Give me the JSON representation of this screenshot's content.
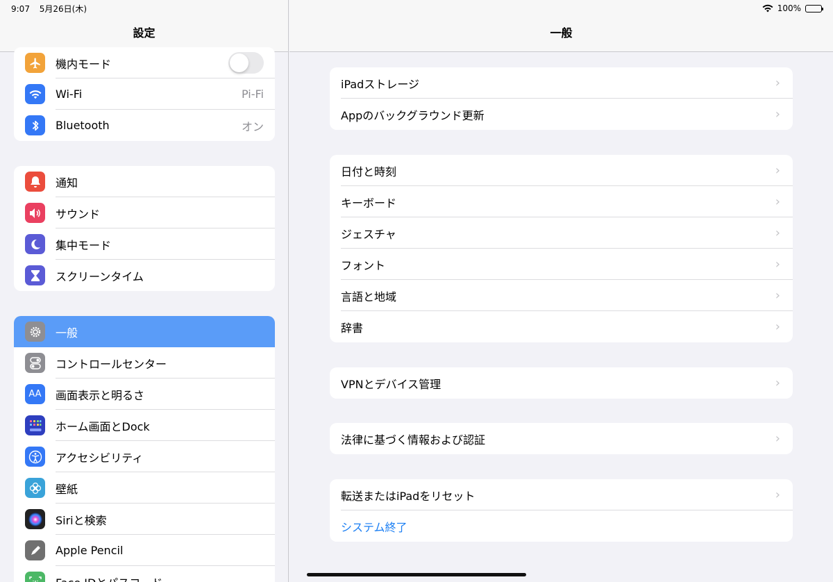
{
  "status": {
    "time": "9:07",
    "date": "5月26日(木)",
    "battery": "100%"
  },
  "sidebar": {
    "title": "設定",
    "group1": [
      {
        "label": "機内モード",
        "icon": "airplane-icon",
        "color": "#f2a33a",
        "toggle": false
      },
      {
        "label": "Wi-Fi",
        "value": "Pi-Fi",
        "icon": "wifi-icon",
        "color": "#3478f6"
      },
      {
        "label": "Bluetooth",
        "value": "オン",
        "icon": "bluetooth-icon",
        "color": "#3478f6"
      }
    ],
    "group2": [
      {
        "label": "通知",
        "icon": "bell-icon",
        "color": "#eb4d3d"
      },
      {
        "label": "サウンド",
        "icon": "speaker-icon",
        "color": "#ea4060"
      },
      {
        "label": "集中モード",
        "icon": "moon-icon",
        "color": "#5b5bd6"
      },
      {
        "label": "スクリーンタイム",
        "icon": "hourglass-icon",
        "color": "#5b5bd6"
      }
    ],
    "group3": [
      {
        "label": "一般",
        "icon": "gear-icon",
        "color": "#8e8e93",
        "selected": true
      },
      {
        "label": "コントロールセンター",
        "icon": "control-center-icon",
        "color": "#8e8e93"
      },
      {
        "label": "画面表示と明るさ",
        "icon": "display-icon",
        "color": "#3478f6",
        "glyph": "AA"
      },
      {
        "label": "ホーム画面とDock",
        "icon": "home-screen-icon",
        "color": "#2e3fbf"
      },
      {
        "label": "アクセシビリティ",
        "icon": "accessibility-icon",
        "color": "#3478f6"
      },
      {
        "label": "壁紙",
        "icon": "wallpaper-icon",
        "color": "#3aa3d9"
      },
      {
        "label": "Siriと検索",
        "icon": "siri-icon",
        "color": "#222222"
      },
      {
        "label": "Apple Pencil",
        "icon": "pencil-icon",
        "color": "#707070"
      },
      {
        "label": "Face IDとパスコード",
        "icon": "faceid-icon",
        "color": "#4cb866"
      }
    ]
  },
  "detail": {
    "title": "一般",
    "sections": [
      [
        "iPadストレージ",
        "Appのバックグラウンド更新"
      ],
      [
        "日付と時刻",
        "キーボード",
        "ジェスチャ",
        "フォント",
        "言語と地域",
        "辞書"
      ],
      [
        "VPNとデバイス管理"
      ],
      [
        "法律に基づく情報および認証"
      ],
      [
        "転送またはiPadをリセット",
        "システム終了"
      ]
    ],
    "shutdown_color": "#1a7ef3"
  }
}
